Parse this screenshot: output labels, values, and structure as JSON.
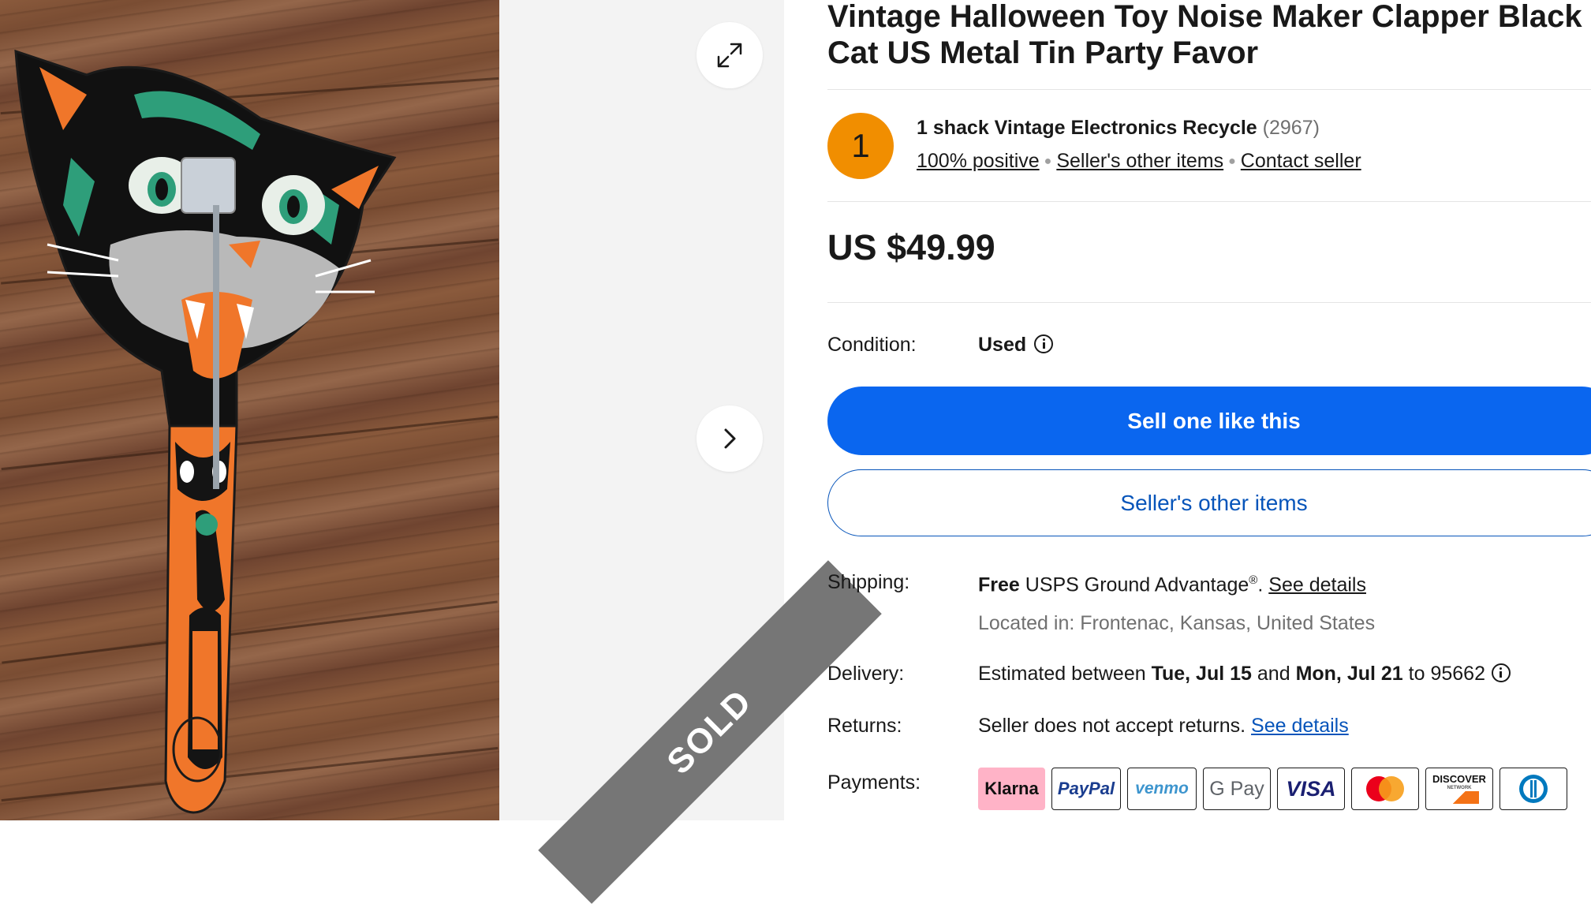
{
  "listing": {
    "title_line1": "Vintage Halloween Toy Noise Maker Clapper Black",
    "title_line2": "Cat US Metal Tin Party Favor",
    "price": "US $49.99",
    "sold_badge": "SOLD"
  },
  "seller": {
    "avatar_letter": "1",
    "name": "1 shack Vintage Electronics Recycle",
    "feedback_count": "(2967)",
    "positive": "100% positive",
    "other_items": "Seller's other items",
    "contact": "Contact seller"
  },
  "condition": {
    "label": "Condition:",
    "value": "Used"
  },
  "buttons": {
    "primary": "Sell one like this",
    "secondary": "Seller's other items"
  },
  "shipping": {
    "label": "Shipping:",
    "free": "Free",
    "service": "USPS Ground Advantage",
    "reg": "®",
    "period": ".",
    "details": "See details",
    "located": "Located in: Frontenac, Kansas, United States"
  },
  "delivery": {
    "label": "Delivery:",
    "pre": "Estimated between",
    "date1": "Tue, Jul 15",
    "and": "and",
    "date2": "Mon, Jul 21",
    "to": "to 95662"
  },
  "returns": {
    "label": "Returns:",
    "text": "Seller does not accept returns.",
    "details": "See details"
  },
  "payments": {
    "label": "Payments:",
    "methods": [
      "Klarna",
      "PayPal",
      "venmo",
      "G Pay",
      "VISA",
      "Mastercard",
      "DISCOVER",
      "Diners Club"
    ],
    "discover_sub": "NETWORK"
  },
  "colors": {
    "accent": "#0a66ef",
    "avatar": "#f18e00",
    "sold_ribbon": "#767676",
    "klarna": "#ffb3c7"
  }
}
